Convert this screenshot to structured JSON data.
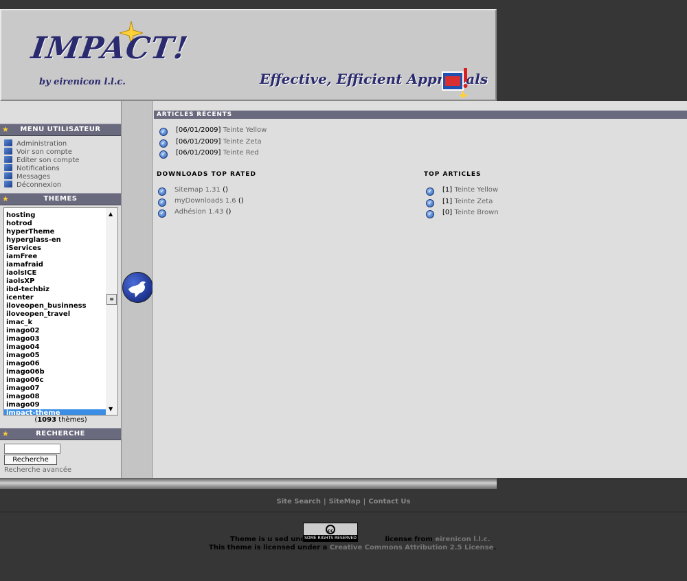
{
  "header": {
    "logo_text": "IMPACT!",
    "logo_sub": "by eirenicon l.l.c.",
    "tagline": "Effective, Efficient Appraisals"
  },
  "sidebar": {
    "menu_title": "MENU UTILISATEUR",
    "menu_items": [
      "Administration",
      "Voir son compte",
      "Editer son compte",
      "Notifications",
      "Messages",
      "Déconnexion"
    ],
    "themes_title": "THEMES",
    "themes": [
      "hosting",
      "hotrod",
      "hyperTheme",
      "hyperglass-en",
      "iServices",
      "iamFree",
      "iamafraid",
      "iaolsICE",
      "iaolsXP",
      "ibd-techbiz",
      "icenter",
      "iloveopen_businness",
      "iloveopen_travel",
      "imac_k",
      "imago02",
      "imago03",
      "imago04",
      "imago05",
      "imago06",
      "imago06b",
      "imago06c",
      "imago07",
      "imago08",
      "imago09",
      "impact-theme"
    ],
    "selected_theme": "impact-theme",
    "theme_count_open": "(",
    "theme_count": "1093",
    "theme_count_label": " thèmes)",
    "search_title": "RECHERCHE",
    "search_value": "",
    "search_button": "Recherche",
    "advanced_search": "Recherche avancée"
  },
  "main": {
    "recent_title": "ARTICLES RÉCENTS",
    "recent": [
      {
        "date": "[06/01/2009]",
        "title": "Teinte Yellow"
      },
      {
        "date": "[06/01/2009]",
        "title": "Teinte Zeta"
      },
      {
        "date": "[06/01/2009]",
        "title": "Teinte Red"
      }
    ],
    "downloads_title": "DOWNLOADS TOP RATED",
    "downloads": [
      {
        "name": "Sitemap 1.31",
        "count": "()"
      },
      {
        "name": "myDownloads 1.6",
        "count": "()"
      },
      {
        "name": "Adhésion 1.43",
        "count": "()"
      }
    ],
    "top_title": "TOP ARTICLES",
    "top": [
      {
        "count": "[1]",
        "title": "Teinte Yellow"
      },
      {
        "count": "[1]",
        "title": "Teinte Zeta"
      },
      {
        "count": "[0]",
        "title": "Teinte Brown"
      }
    ]
  },
  "footer": {
    "links": [
      "Site Search",
      "SiteMap",
      "Contact Us"
    ],
    "cc_badge": "cc",
    "cc_rights": "SOME RIGHTS RESERVED",
    "line1_prefix": "Theme is u sed under",
    "line1_mid": "license from",
    "line1_link": "eirenicon l.l.c.",
    "line2_prefix": "This theme  is licensed under a",
    "line2_link": "Creative Commons Attribution 2.5 License",
    "line2_suffix": "."
  },
  "colors": {
    "page_bg": "#363636",
    "block_header": "#6a6a7e",
    "panel_bg": "#dedede",
    "selection": "#3a8ee6"
  }
}
